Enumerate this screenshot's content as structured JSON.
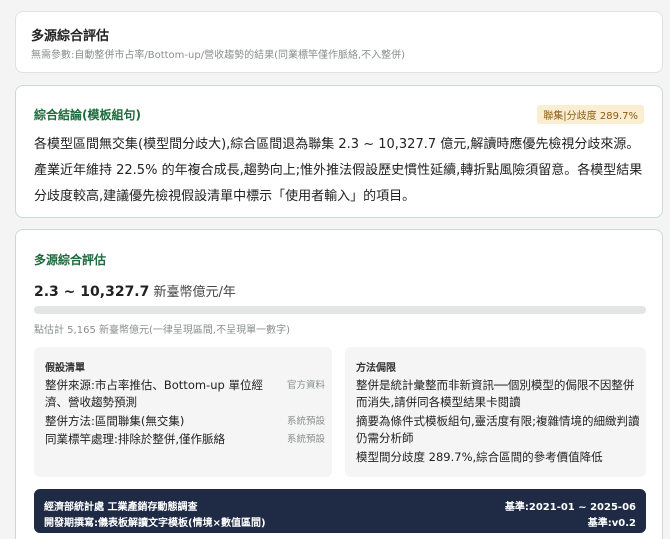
{
  "header": {
    "title": "多源綜合評估",
    "subtitle": "無需參數:自動整併市占率/Bottom-up/營收趨勢的結果(同業標竿僅作脈絡,不入整併)"
  },
  "conclusion": {
    "title": "綜合結論(模板組句)",
    "badge": "聯集|分歧度 289.7%",
    "text": "各模型區間無交集(模型間分歧大),綜合區間退為聯集 2.3 ~ 10,327.7 億元,解讀時應優先檢視分歧來源。產業近年維持 22.5% 的年複合成長,趨勢向上;惟外推法假設歷史慣性延續,轉折點風險須留意。各模型結果分歧度較高,建議優先檢視假設清單中標示「使用者輸入」的項目。"
  },
  "main": {
    "title": "多源綜合評估",
    "range_value": "2.3 ~ 10,327.7",
    "range_unit": " 新臺幣億元/年",
    "bar_fill_fraction": 0,
    "point_note": "點估計 5,165 新臺幣億元(一律呈現區間,不呈現單一數字)",
    "assumptions": {
      "title": "假設清單",
      "rows": [
        {
          "text": "整併來源:市占率推估、Bottom-up 單位經濟、營收趨勢預測",
          "tag": "官方資料"
        },
        {
          "text": "整併方法:區間聯集(無交集)",
          "tag": "系統預設"
        },
        {
          "text": "同業標竿處理:排除於整併,僅作脈絡",
          "tag": "系統預設"
        }
      ]
    },
    "limitations": {
      "title": "方法侷限",
      "items": [
        "整併是統計彙整而非新資訊──個別模型的侷限不因整併而消失,請併同各模型結果卡閱讀",
        "摘要為條件式模板組句,靈活度有限;複雜情境的細緻判讀仍需分析師",
        "模型間分歧度 289.7%,綜合區間的參考價值降低"
      ]
    },
    "footer": {
      "source": "經濟部統計處 工業產銷存動態調查",
      "period": "基準:2021-01 ~ 2025-06",
      "note": "開發期撰寫:儀表板解讀文字模板(情境×數值區間)",
      "version": "基準:v0.2"
    }
  }
}
